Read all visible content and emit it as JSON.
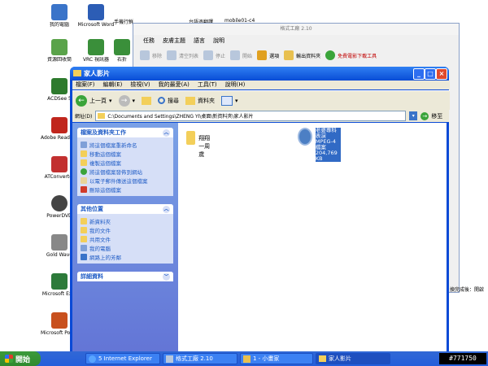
{
  "desktop_icons": [
    {
      "label": "我的電腦",
      "color": "#3a74c9"
    },
    {
      "label": "資源回收筒",
      "color": "#5aa34a"
    },
    {
      "label": "ACDSee 5",
      "color": "#2d7a2d"
    },
    {
      "label": "Adobe Reader 8",
      "color": "#c0261d"
    },
    {
      "label": "ATConverter",
      "color": "#c23030"
    },
    {
      "label": "PowerDVD",
      "color": "#444444"
    },
    {
      "label": "Gold Wave",
      "color": "#888888"
    },
    {
      "label": "Microsoft Ex...",
      "color": "#2c7a3a"
    },
    {
      "label": "Microsoft PowerPoint",
      "color": "#c8501e"
    },
    {
      "label": "Microsoft Word",
      "color": "#2c5db5"
    },
    {
      "label": "VRC 視訊器",
      "color": "#3a8f3a"
    },
    {
      "label": "右折",
      "color": "#3a8f3a"
    }
  ],
  "top_desktop_labels": [
    "手機行鮮",
    "台語逐翻譯",
    "mobile01-c4"
  ],
  "bg_window": {
    "title": "格式工廠 2.10",
    "menu": [
      "任務",
      "皮膚主題",
      "語言",
      "說明"
    ],
    "tools": [
      "移除",
      "清空列表",
      "停止",
      "開始",
      "選項",
      "輸出資料夾",
      "免費電影下載工具"
    ]
  },
  "explorer": {
    "title": "家人影片",
    "menu": [
      "檔案(F)",
      "編輯(E)",
      "檢視(V)",
      "我的最愛(A)",
      "工具(T)",
      "說明(H)"
    ],
    "back_label": "上一頁",
    "search_label": "搜尋",
    "folders_label": "資料夾",
    "address_label": "網址(D)",
    "address": "C:\\Documents and Settings\\ZHENG YI\\桌面\\新資料夾\\家人影片",
    "go_label": "移至",
    "panels": {
      "tasks_title": "檔案及資料夾工作",
      "tasks": [
        "將這個檔案重新命名",
        "移動這個檔案",
        "複製這個檔案",
        "將這個檔案發佈到網站",
        "以電子郵件傳送這個檔案",
        "刪除這個檔案"
      ],
      "places_title": "其他位置",
      "places": [
        "新資料夾",
        "我的文件",
        "共用文件",
        "我的電腦",
        "網路上的芳鄰"
      ],
      "details_title": "詳細資料"
    },
    "files": [
      {
        "name": "翔翔一周歲"
      },
      {
        "name": "老婆專科表演",
        "type": "MPEG-4 檔案",
        "size": "204,769 KB"
      }
    ]
  },
  "taskbar": {
    "start_label": "開始",
    "tasks": [
      "5 Internet Explorer",
      "格式工廠 2.10",
      "1 - 小畫家",
      "家人影片"
    ]
  },
  "right_fragments": [
    "換完成後：開啟"
  ],
  "watermark": "#771750"
}
